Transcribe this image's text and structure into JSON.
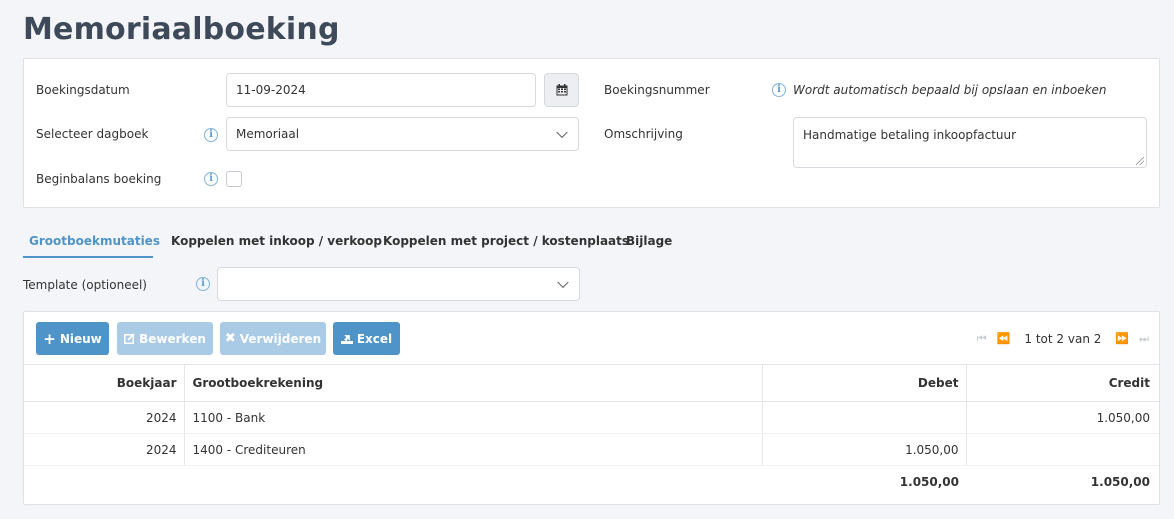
{
  "page": {
    "title": "Memoriaalboeking"
  },
  "form": {
    "booking_date_label": "Boekingsdatum",
    "booking_date_value": "11-09-2024",
    "journal_label": "Selecteer dagboek",
    "journal_value": "Memoriaal",
    "opening_balance_label": "Beginbalans boeking",
    "opening_balance_checked": false,
    "booking_number_label": "Boekingsnummer",
    "booking_number_note": "Wordt automatisch bepaald bij opslaan en inboeken",
    "description_label": "Omschrijving",
    "description_value": "Handmatige betaling inkoopfactuur"
  },
  "tabs": [
    {
      "label": "Grootboekmutaties",
      "active": true
    },
    {
      "label": "Koppelen met inkoop / verkoop",
      "active": false
    },
    {
      "label": "Koppelen met project / kostenplaats",
      "active": false
    },
    {
      "label": "Bijlage",
      "active": false
    }
  ],
  "template": {
    "label": "Template (optioneel)",
    "value": ""
  },
  "toolbar": {
    "new_label": "Nieuw",
    "edit_label": "Bewerken",
    "delete_label": "Verwijderen",
    "excel_label": "Excel"
  },
  "pager": {
    "text": "1 tot 2 van 2"
  },
  "table": {
    "headers": {
      "year": "Boekjaar",
      "account": "Grootboekrekening",
      "debit": "Debet",
      "credit": "Credit"
    },
    "rows": [
      {
        "year": "2024",
        "account": "1100 - Bank",
        "debit": "",
        "credit": "1.050,00"
      },
      {
        "year": "2024",
        "account": "1400 - Crediteuren",
        "debit": "1.050,00",
        "credit": ""
      }
    ],
    "totals": {
      "debit": "1.050,00",
      "credit": "1.050,00"
    }
  },
  "colors": {
    "accent": "#4f94c8",
    "accent_disabled": "#a9cbe6",
    "title": "#3e4a5a"
  }
}
